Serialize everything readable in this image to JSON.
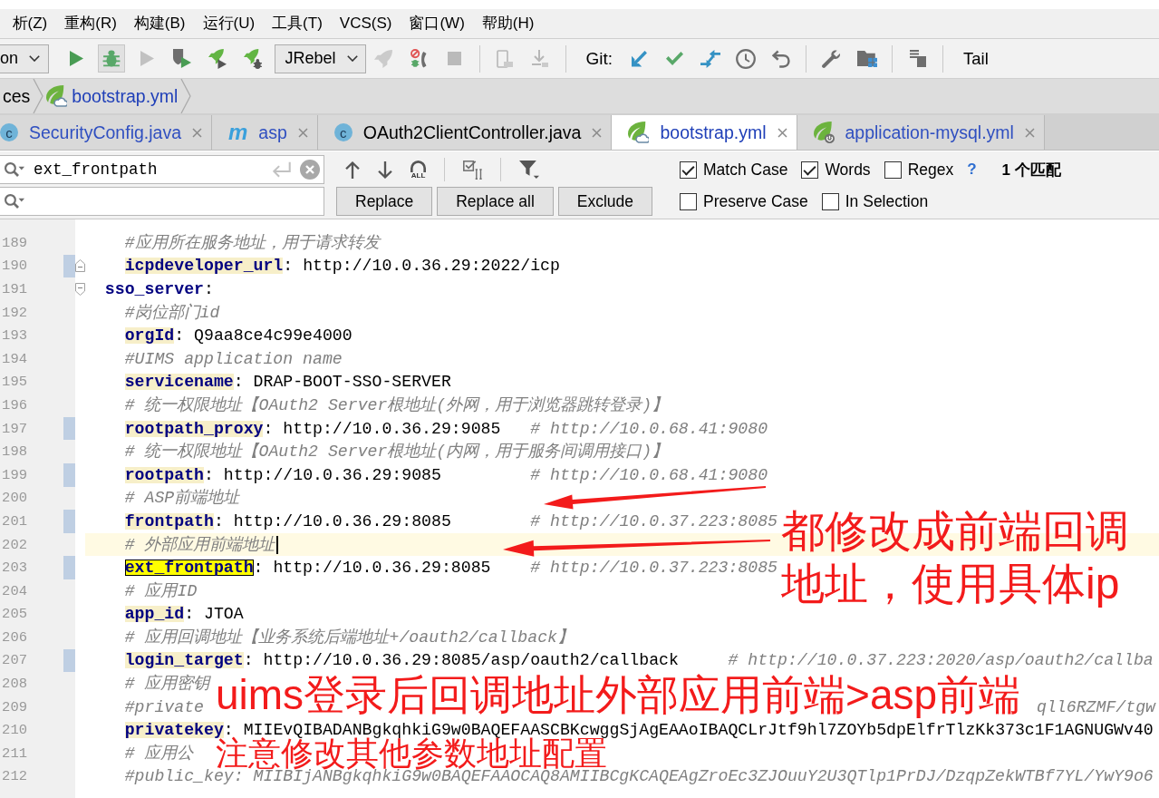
{
  "menu_bar": {
    "items": [
      "析(Z)",
      "重构(R)",
      "构建(B)",
      "运行(U)",
      "工具(T)",
      "VCS(S)",
      "窗口(W)",
      "帮助(H)"
    ]
  },
  "toolbar": {
    "run_config": "on",
    "run_buttons": [
      {
        "disabled": false,
        "pressed": false
      },
      {
        "disabled": false,
        "pressed": true
      },
      {
        "disabled": true,
        "pressed": false
      },
      {
        "disabled": false,
        "pressed": false
      },
      {
        "disabled": false,
        "pressed": false
      },
      {
        "disabled": false,
        "pressed": false
      }
    ],
    "jrebel": "JRebel",
    "jrebel_buttons": [
      {
        "disabled": true
      },
      {
        "disabled": false
      },
      {
        "disabled": true
      }
    ],
    "device_buttons": [
      {
        "disabled": true
      },
      {
        "disabled": true
      }
    ],
    "git_label": "Git:",
    "git_buttons": [
      {
        "disabled": false
      },
      {
        "disabled": false
      },
      {
        "disabled": false
      },
      {
        "disabled": false
      },
      {
        "disabled": false
      }
    ],
    "tool_buttons": [
      {
        "disabled": false
      },
      {
        "disabled": false
      },
      {
        "disabled": false
      }
    ],
    "tail": "Tail"
  },
  "breadcrumb": [
    {
      "label": "ces",
      "kind": "folder",
      "color": "#000000"
    },
    {
      "label": "bootstrap.yml",
      "kind": "yml",
      "color": "#1f3fb8"
    }
  ],
  "tabs": [
    {
      "label": "SecurityConfig.java",
      "kind": "class",
      "icon_text": "c",
      "color": "#2f4fc0",
      "selected": false
    },
    {
      "label": "asp",
      "kind": "module",
      "icon_text": "m",
      "color": "#2f4fc0",
      "selected": false
    },
    {
      "label": "OAuth2ClientController.java",
      "kind": "class",
      "icon_text": "c",
      "color": "#000000",
      "selected": false
    },
    {
      "label": "bootstrap.yml",
      "kind": "spring-cloud",
      "color": "#1f3fb8",
      "selected": true
    },
    {
      "label": "application-mysql.yml",
      "kind": "spring-boot",
      "color": "#2f4fc0",
      "selected": false
    }
  ],
  "find_bar": {
    "search_value": "ext_frontpath",
    "select_all_label": "ALL",
    "buttons": [
      "Replace",
      "Replace all",
      "Exclude"
    ],
    "options_top": [
      {
        "label": "Match Case",
        "checked": true
      },
      {
        "label": "Words",
        "checked": true
      },
      {
        "label": "Regex",
        "checked": false
      }
    ],
    "help": "?",
    "match_count": "1 个匹配",
    "options_bottom": [
      {
        "label": "Preserve Case",
        "checked": false
      },
      {
        "label": "In Selection",
        "checked": false
      }
    ]
  },
  "editor": {
    "lines": [
      {
        "children": [
          {
            "number": "189",
            "kind": "comment",
            "text": "#应用所在服务地址，用于请求转发",
            "changed": false,
            "current": false,
            "fold_start": false,
            "fold_end": false
          },
          {
            "number": "190",
            "kind": "pair",
            "key": "icpdeveloper_url",
            "rest": ": http://10.0.36.29:2022/icp",
            "changed": true,
            "current": false,
            "match": false,
            "fold_start": false,
            "fold_end": true
          }
        ]
      },
      {
        "number": "191",
        "kind": "section",
        "key": "sso_server",
        "rest": ":",
        "changed": false,
        "current": false,
        "fold_start": true,
        "fold_end": false,
        "children": [
          {
            "number": "192",
            "kind": "comment",
            "text": "#岗位部门id",
            "changed": false,
            "current": false,
            "fold_start": false,
            "fold_end": false
          },
          {
            "number": "193",
            "kind": "pair",
            "key": "orgId",
            "rest": ": Q9aa8ce4c99e4000",
            "changed": false,
            "current": false,
            "match": false,
            "fold_start": false,
            "fold_end": false
          },
          {
            "number": "194",
            "kind": "comment",
            "text": "#UIMS application name",
            "changed": false,
            "current": false,
            "fold_start": false,
            "fold_end": false
          },
          {
            "number": "195",
            "kind": "pair",
            "key": "servicename",
            "rest": ": DRAP-BOOT-SSO-SERVER",
            "changed": false,
            "current": false,
            "match": false,
            "fold_start": false,
            "fold_end": false
          },
          {
            "number": "196",
            "kind": "comment",
            "text": "# 统一权限地址【OAuth2 Server根地址(外网，用于浏览器跳转登录)】",
            "changed": false,
            "current": false,
            "fold_start": false,
            "fold_end": false
          },
          {
            "number": "197",
            "kind": "pair",
            "key": "rootpath_proxy",
            "rest": ": http://10.0.36.29:9085",
            "comment": "# http://10.0.68.41:9080",
            "changed": true,
            "current": false,
            "match": false,
            "fold_start": false,
            "fold_end": false
          },
          {
            "number": "198",
            "kind": "comment",
            "text": "# 统一权限地址【OAuth2 Server根地址(内网，用于服务间调用接口)】",
            "changed": false,
            "current": false,
            "fold_start": false,
            "fold_end": false
          },
          {
            "number": "199",
            "kind": "pair",
            "key": "rootpath",
            "rest": ": http://10.0.36.29:9085",
            "comment": "# http://10.0.68.41:9080",
            "changed": true,
            "current": false,
            "match": false,
            "fold_start": false,
            "fold_end": false
          },
          {
            "number": "200",
            "kind": "comment",
            "text": "# ASP前端地址",
            "changed": false,
            "current": false,
            "fold_start": false,
            "fold_end": false
          },
          {
            "number": "201",
            "kind": "pair",
            "key": "frontpath",
            "rest": ": http://10.0.36.29:8085",
            "comment": "# http://10.0.37.223:8085",
            "changed": true,
            "current": false,
            "match": false,
            "fold_start": false,
            "fold_end": false
          },
          {
            "number": "202",
            "kind": "comment",
            "text": "# 外部应用前端地址",
            "changed": false,
            "current": true,
            "fold_start": false,
            "fold_end": false
          },
          {
            "number": "203",
            "kind": "pair",
            "key": "ext_frontpath",
            "rest": ": http://10.0.36.29:8085",
            "comment": "# http://10.0.37.223:8085",
            "changed": true,
            "current": false,
            "match": true,
            "fold_start": false,
            "fold_end": false
          },
          {
            "number": "204",
            "kind": "comment",
            "text": "# 应用ID",
            "changed": false,
            "current": false,
            "fold_start": false,
            "fold_end": false
          },
          {
            "number": "205",
            "kind": "pair",
            "key": "app_id",
            "rest": ": JTOA",
            "changed": false,
            "current": false,
            "match": false,
            "fold_start": false,
            "fold_end": false
          },
          {
            "number": "206",
            "kind": "comment",
            "text": "# 应用回调地址【业务系统后端地址+/oauth2/callback】",
            "changed": false,
            "current": false,
            "fold_start": false,
            "fold_end": false
          },
          {
            "number": "207",
            "kind": "pair",
            "key": "login_target",
            "rest": ": http://10.0.36.29:8085/asp/oauth2/callback",
            "comment": "# http://10.0.37.223:2020/asp/oauth2/callba",
            "changed": true,
            "current": false,
            "match": false,
            "fold_start": false,
            "fold_end": false
          },
          {
            "number": "208",
            "kind": "comment",
            "text": "# 应用密钥",
            "changed": false,
            "current": false,
            "fold_start": false,
            "fold_end": false
          },
          {
            "number": "209",
            "kind": "covered",
            "text": "#private",
            "tail": "qll6RZMF/tgw",
            "changed": false,
            "current": false,
            "fold_start": false,
            "fold_end": false
          },
          {
            "number": "210",
            "kind": "pair",
            "key": "privatekey",
            "rest": ": MIIEvQIBADANBgkqhkiG9w0BAQEFAASCBKcwggSjAgEAAoIBAQCLrJtf9hl7ZOYb5dpElfrTlzKk373c1F1AGNUGWv40",
            "changed": false,
            "current": false,
            "match": false,
            "fold_start": false,
            "fold_end": false
          },
          {
            "number": "211",
            "kind": "comment",
            "text": "# 应用公",
            "changed": false,
            "current": false,
            "fold_start": false,
            "fold_end": false
          },
          {
            "number": "212",
            "kind": "comment",
            "text": "#public_key: MIIBIjANBgkqhkiG9w0BAQEFAAOCAQ8AMIIBCgKCAQEAgZroEc3ZJOuuY2U3QTlp1PrDJ/DzqpZekWTBf7YL/YwY9o6",
            "changed": false,
            "current": false,
            "fold_start": false,
            "fold_end": false
          }
        ]
      }
    ]
  },
  "annotations": [
    {
      "kind": "note",
      "text": "都修改成前端回调地址，使用具体ip"
    },
    {
      "kind": "arrow"
    },
    {
      "kind": "arrow"
    },
    {
      "kind": "note",
      "text": "uims登录后回调地址外部应用前端>asp前端"
    },
    {
      "kind": "note",
      "text": "注意修改其他参数地址配置"
    }
  ]
}
